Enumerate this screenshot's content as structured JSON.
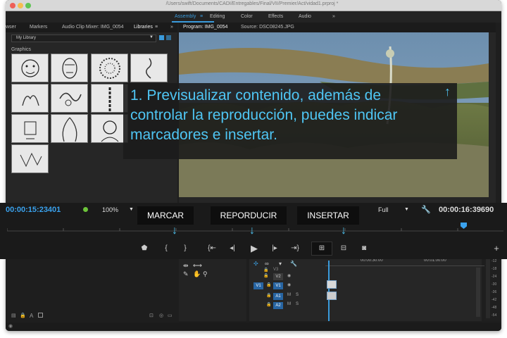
{
  "window": {
    "title_path": "/Users/swift/Documents/CADI/Entregables/Final/VII/Premier/Act/vidad1.prproj *"
  },
  "workspaces": [
    {
      "label": "Assembly",
      "active": true
    },
    {
      "label": "Editing",
      "active": false
    },
    {
      "label": "Color",
      "active": false
    },
    {
      "label": "Effects",
      "active": false
    },
    {
      "label": "Audio",
      "active": false
    }
  ],
  "left_tabs": [
    "wser",
    "Markers",
    "Audio Clip Mixer: IMG_0054",
    "Libraries"
  ],
  "library": {
    "select_value": "My Library",
    "section_label": "Graphics"
  },
  "program_tabs": [
    "Program: IMG_0054",
    "Source: DSC08245.JPG"
  ],
  "monitor": {
    "timecode_current": "00:00:15:23401",
    "zoom": "100%",
    "resolution": "Full",
    "timecode_duration": "00:00:16:39690"
  },
  "callout": {
    "text": "1. Previsualizar contenido, además de controlar la reproducción, puedes indicar marcadores e insertar."
  },
  "labels": {
    "marcar": "MARCAR",
    "reproducir": "REPORDUCIR",
    "insertar": "INSERTAR"
  },
  "controls": {
    "mark_in": "{",
    "mark_out": "}"
  },
  "tracks": [
    {
      "target": "",
      "lock": "🔒",
      "name": "V3"
    },
    {
      "target": "",
      "lock": "🔒",
      "name": "V2"
    },
    {
      "target": "V1",
      "lock": "🔒",
      "name": "V1"
    },
    {
      "target": "",
      "lock": "🔒",
      "name": "A1"
    },
    {
      "target": "",
      "lock": "🔒",
      "name": "A2"
    }
  ],
  "track_toggles": {
    "m": "M",
    "s": "S"
  },
  "timeline": {
    "ruler_time_1": "00:00:30:00",
    "ruler_time_2": "00:01:00:00"
  },
  "meter_ticks": [
    "-12",
    "-18",
    "-24",
    "-30",
    "-36",
    "-42",
    "-48",
    "-54"
  ],
  "bottom_left_text": "A",
  "colors": {
    "accent": "#3a9bdc",
    "callout_text": "#4fc6f4"
  }
}
